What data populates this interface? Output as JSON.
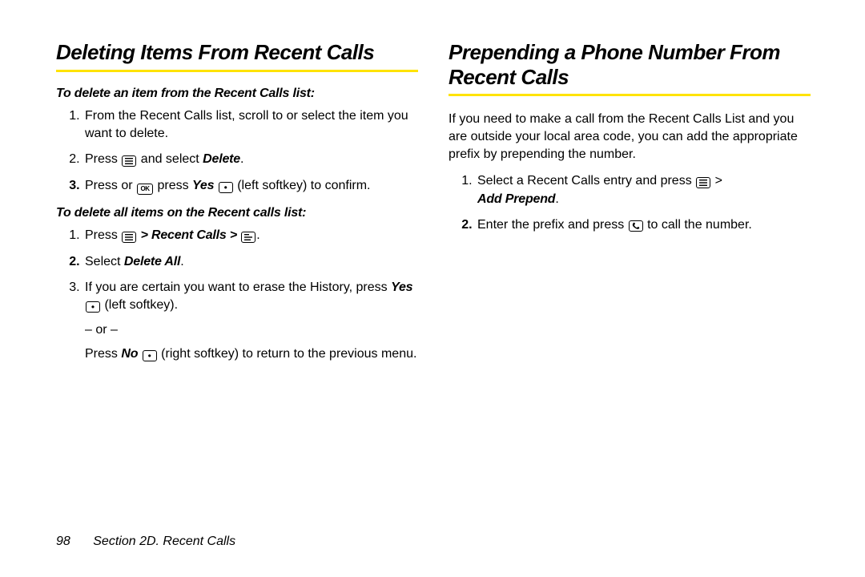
{
  "left": {
    "heading": "Deleting Items From Recent Calls",
    "sub1": "To delete an item from the Recent Calls list:",
    "s1_1": "From the Recent Calls list, scroll to or select the item you want to delete.",
    "s1_2a": "Press ",
    "s1_2b": " and select ",
    "s1_2c": "Delete",
    "s1_2d": ".",
    "s1_3a": "Press or ",
    "s1_3b": " press ",
    "s1_3c": "Yes",
    "s1_3d": " (left softkey) to confirm.",
    "sub2": "To delete all items on the Recent calls list:",
    "s2_1a": "Press ",
    "s2_1b": " > ",
    "s2_1c": "Recent Calls",
    "s2_1d": " > ",
    "s2_1e": ".",
    "s2_2a": "Select  ",
    "s2_2b": "Delete All",
    "s2_2c": ".",
    "s2_3a": "If you are certain you want to erase the History, press ",
    "s2_3b": "Yes",
    "s2_3c": " (left softkey).",
    "s2_3or": "– or –",
    "s2_3d": "Press ",
    "s2_3e": "No",
    "s2_3f": " (right softkey) to return to the previous menu."
  },
  "right": {
    "heading": "Prepending a Phone Number From Recent Calls",
    "intro": "If you need to make a call from the Recent Calls List and you are outside your local area code, you can add the appropriate prefix by prepending the number.",
    "r1a": "Select a Recent Calls entry and press ",
    "r1b": " > ",
    "r1c": "Add Prepend",
    "r1d": ".",
    "r2a": "Enter the prefix and press ",
    "r2b": " to call the number."
  },
  "footer": {
    "page": "98",
    "section": "Section 2D. Recent Calls"
  }
}
